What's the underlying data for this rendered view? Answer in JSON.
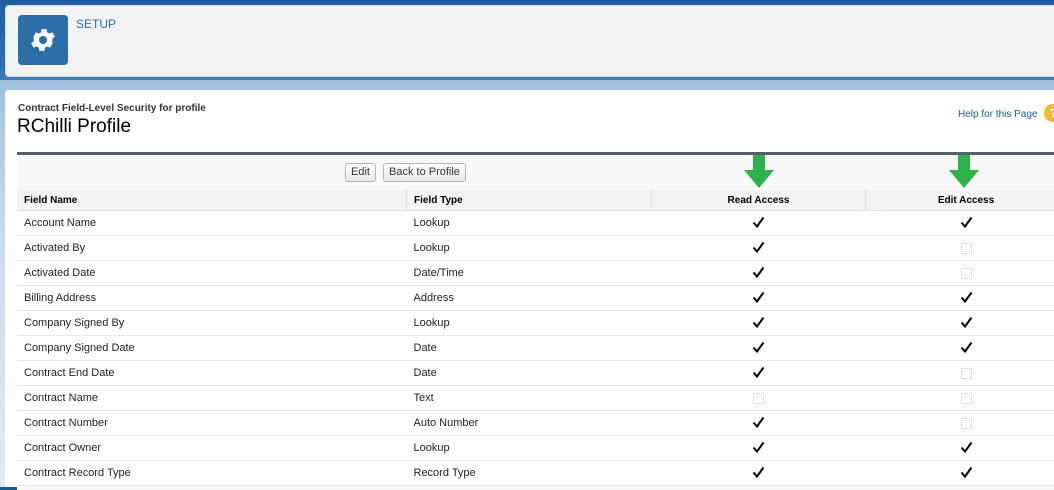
{
  "header": {
    "setup_label": "SETUP",
    "icon": "gear-icon"
  },
  "page": {
    "subtitle": "Contract Field-Level Security for profile",
    "title": "RChilli Profile",
    "help_link": "Help for this Page",
    "help_icon": "?"
  },
  "toolbar": {
    "edit_label": "Edit",
    "back_label": "Back to Profile"
  },
  "table": {
    "headers": {
      "field_name": "Field Name",
      "field_type": "Field Type",
      "read_access": "Read Access",
      "edit_access": "Edit Access"
    },
    "rows": [
      {
        "name": "Account Name",
        "type": "Lookup",
        "read": true,
        "edit": true
      },
      {
        "name": "Activated By",
        "type": "Lookup",
        "read": true,
        "edit": false
      },
      {
        "name": "Activated Date",
        "type": "Date/Time",
        "read": true,
        "edit": false
      },
      {
        "name": "Billing Address",
        "type": "Address",
        "read": true,
        "edit": true
      },
      {
        "name": "Company Signed By",
        "type": "Lookup",
        "read": true,
        "edit": true
      },
      {
        "name": "Company Signed Date",
        "type": "Date",
        "read": true,
        "edit": true
      },
      {
        "name": "Contract End Date",
        "type": "Date",
        "read": true,
        "edit": false
      },
      {
        "name": "Contract Name",
        "type": "Text",
        "read": false,
        "edit": false
      },
      {
        "name": "Contract Number",
        "type": "Auto Number",
        "read": true,
        "edit": false
      },
      {
        "name": "Contract Owner",
        "type": "Lookup",
        "read": true,
        "edit": true
      },
      {
        "name": "Contract Record Type",
        "type": "Record Type",
        "read": true,
        "edit": true
      }
    ]
  },
  "colors": {
    "arrow": "#2db34a",
    "setup_tile": "#2b6fa8",
    "link": "#1a5ea0"
  }
}
